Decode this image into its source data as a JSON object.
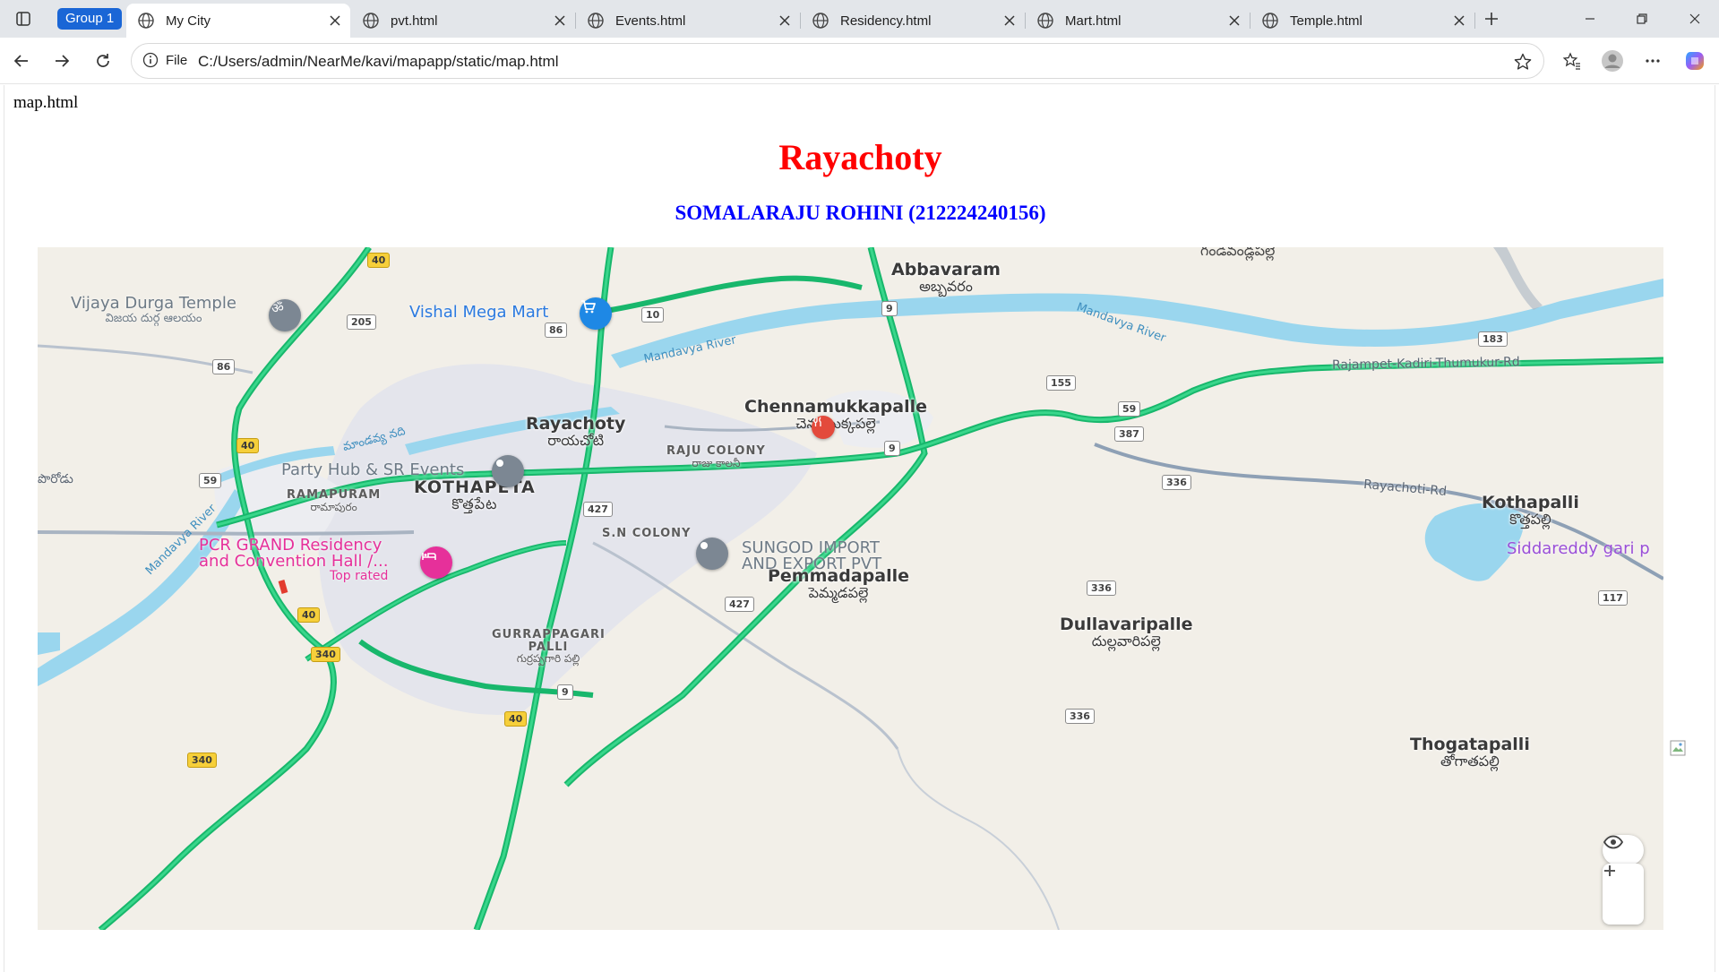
{
  "browser": {
    "tab_group_label": "Group 1",
    "tabs": [
      {
        "label": "My City",
        "active": true
      },
      {
        "label": "pvt.html",
        "active": false
      },
      {
        "label": "Events.html",
        "active": false
      },
      {
        "label": "Residency.html",
        "active": false
      },
      {
        "label": "Mart.html",
        "active": false
      },
      {
        "label": "Temple.html",
        "active": false
      }
    ],
    "site_info_label": "File",
    "url": "C:/Users/admin/NearMe/kavi/mapapp/static/map.html"
  },
  "page": {
    "doc_title": "map.html",
    "heading": "Rayachoty",
    "subheading": "SOMALARAJU ROHINI (212224240156)",
    "heading_color": "#ff0000",
    "subheading_color": "#0000ff"
  },
  "map": {
    "towns": [
      {
        "name": "Abbavaram",
        "telugu": "అబ్బవరం"
      },
      {
        "name": "Rayachoty",
        "telugu": "రాయచోటి"
      },
      {
        "name": "Chennamukkapalle",
        "telugu": "చెన్నముక్కపల్లె"
      },
      {
        "name": "Kothapalli",
        "telugu": "కొత్తపల్లి"
      },
      {
        "name": "Pemmadapalle",
        "telugu": "పెమ్మడపల్లె"
      },
      {
        "name": "Dullavaripalle",
        "telugu": "దుల్లవారిపల్లె"
      },
      {
        "name": "Thogatapalli",
        "telugu": "తోగాతపల్లి"
      },
      {
        "name": "KOTHAPETA",
        "telugu": "కొత్తపేట"
      }
    ],
    "areas": [
      {
        "name": "RAJU COLONY",
        "telugu": "రాజు కాలనీ"
      },
      {
        "name": "RAMAPURAM",
        "telugu": "రామాపురం"
      },
      {
        "name": "S.N COLONY",
        "telugu": ""
      },
      {
        "name": "GURRAPPAGARI PALLI",
        "telugu": "గుర్రప్పగారి పల్లి"
      }
    ],
    "top_telugu_label": "గండివండ్లపల్లె",
    "poi": {
      "temple": {
        "name": "Vijaya Durga Temple",
        "telugu": "విజయ దుర్గ ఆలయం"
      },
      "mart": {
        "name": "Vishal Mega Mart"
      },
      "events": {
        "name": "Party Hub & SR Events"
      },
      "residency": {
        "line1": "PCR GRAND Residency",
        "line2": "and Convention Hall /...",
        "badge": "Top rated"
      },
      "sungod": {
        "line1": "SUNGOD IMPORT",
        "line2": "AND EXPORT PVT"
      },
      "siddareddy": {
        "name": "Siddareddy gari p"
      }
    },
    "water": {
      "mandavya_1": "Mandavya River",
      "mandavya_2": "Mandavya River",
      "mandavya_3": "Mandavya River",
      "telugu_river": "మాండవ్య నది"
    },
    "roads": {
      "rajampet": "Rajampet-Kadiri-Thumukur-Rd",
      "rayachoti": "Rayachoti-Rd",
      "left_edge": "పొరోడు"
    },
    "shields": {
      "nh40": "40",
      "nh340": "340",
      "nh9": "9",
      "nh10": "10",
      "nh59": "59",
      "nh387": "387",
      "nh427": "427",
      "sh86": "86",
      "sh205": "205",
      "sh155": "155",
      "sh183": "183",
      "sh336": "336",
      "sh117": "117"
    },
    "marker_icons": {
      "temple": "om-icon",
      "mart": "cart-icon",
      "events": "pin-icon",
      "residency": "bed-icon",
      "chennamukkapalle": "food-icon",
      "sungod": "pin-icon"
    },
    "colors": {
      "land": "#f2efe8",
      "water": "#9ad6ee",
      "highway": "#22c47a",
      "road": "#a9b4c2",
      "urban": "#e3e4ea"
    }
  }
}
